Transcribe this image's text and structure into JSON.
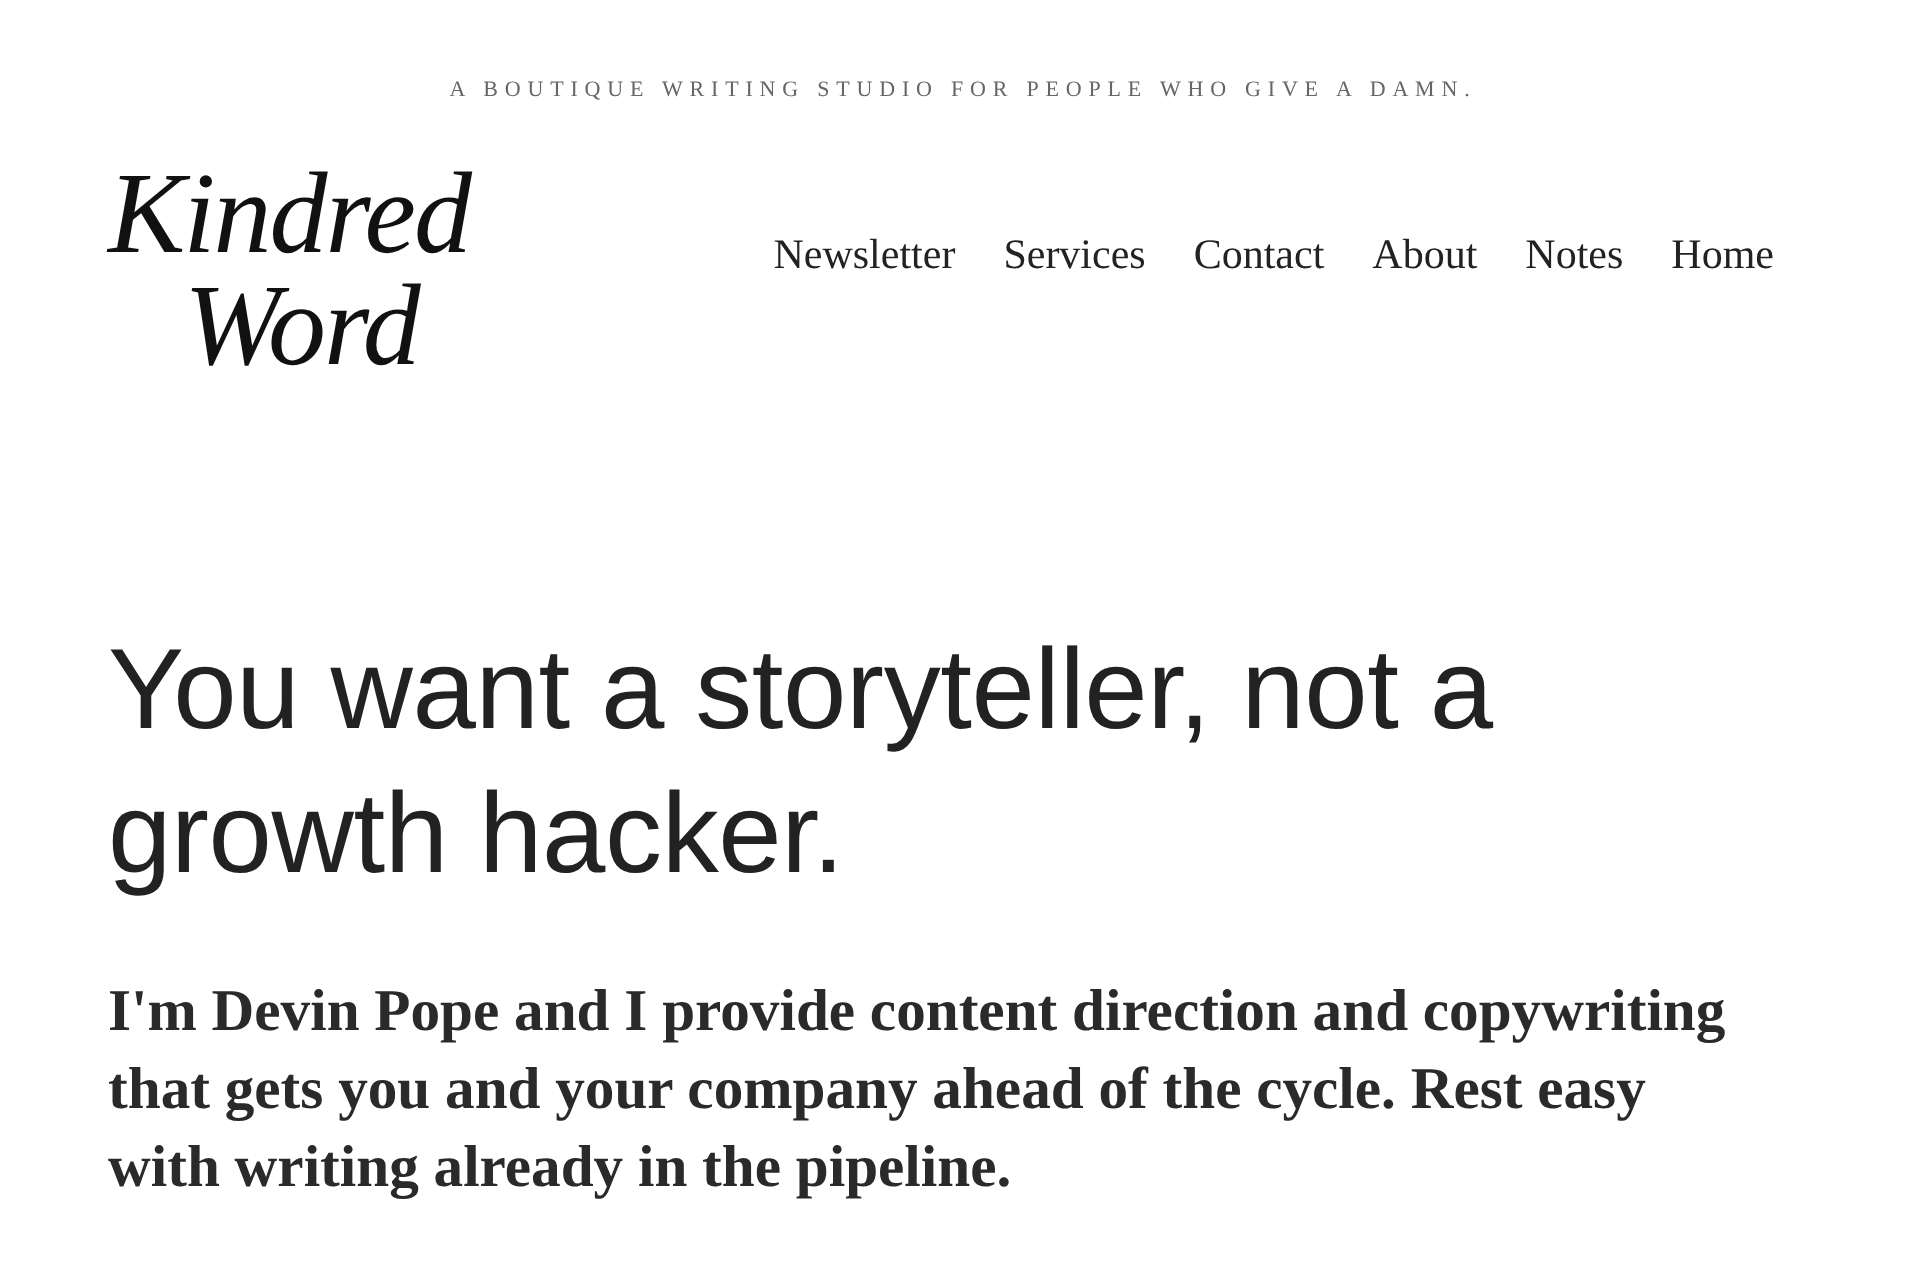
{
  "tagline": "A BOUTIQUE WRITING STUDIO FOR PEOPLE WHO GIVE A DAMN.",
  "logo": {
    "lines": [
      "Kindred",
      "Word"
    ]
  },
  "nav": [
    "Newsletter",
    "Services",
    "Contact",
    "About",
    "Notes",
    "Home"
  ],
  "hero": {
    "headline": "You want a storyteller, not a growth hacker.",
    "intro": "I'm Devin Pope and I provide content direction and copywriting that gets you and your company ahead of the cycle. Rest easy with writing already in the pipeline."
  }
}
